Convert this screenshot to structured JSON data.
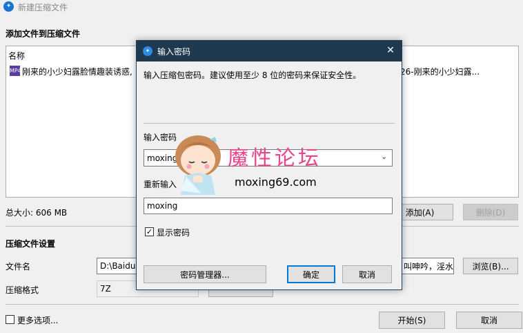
{
  "window": {
    "title": "新建压缩文件",
    "add_section_title": "添加文件到压缩文件",
    "file_list": {
      "column_name": "名称",
      "rows": [
        {
          "name": "刚来的小少妇露脸情趣装诱惑,",
          "name_right": "26-刚来的小少妇露..."
        }
      ]
    },
    "total_size": "总大小: 606 MB",
    "add_button": "添加(A)",
    "delete_button": "删除(D)",
    "settings_title": "压缩文件设置",
    "filename_label": "文件名",
    "filename_value": "D:\\Baidu",
    "filename_value_right": "叫呻吟，淫水",
    "browse_button": "浏览(B)...",
    "format_label": "压缩格式",
    "format_value": "7Z",
    "more_options_label": "更多选项...",
    "start_button": "开始(S)",
    "cancel_button": "取消"
  },
  "dialog": {
    "title": "输入密码",
    "description": "输入压缩包密码。建议使用至少 8 位的密码来保证安全性。",
    "password_label": "输入密码",
    "password_value": "moxing",
    "confirm_label": "重新输入",
    "confirm_value": "moxing",
    "show_password_label": "显示密码",
    "show_password_checked": true,
    "password_manager_button": "密码管理器...",
    "ok_button": "确定",
    "cancel_button": "取消"
  },
  "watermark": {
    "text_cn": "魔性论坛",
    "text_en": "moxing69.com"
  },
  "colors": {
    "dialog_title_bg": "#1f3a4f",
    "primary_border": "#0078d7",
    "watermark_pink": "#e8458b"
  }
}
